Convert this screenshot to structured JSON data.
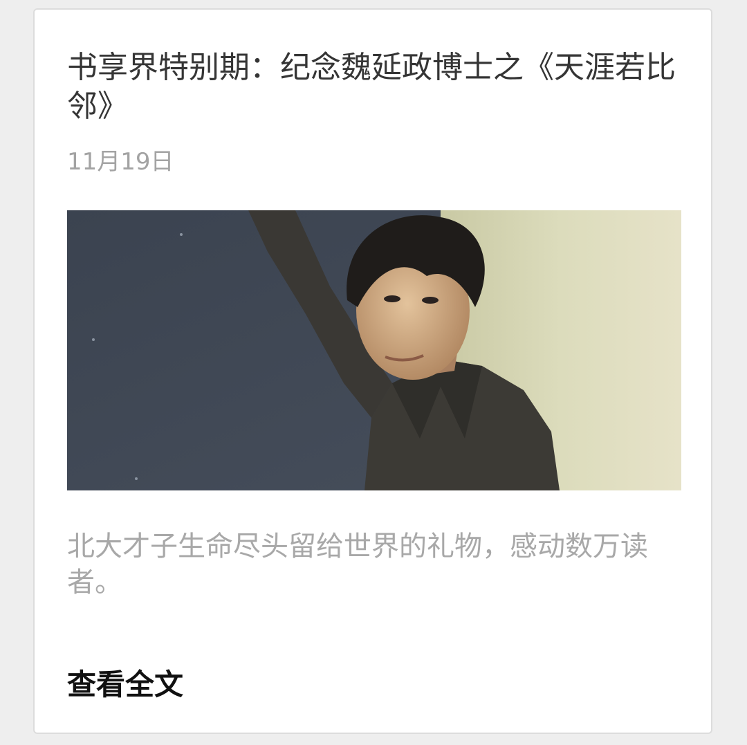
{
  "article": {
    "title": "书享界特别期：纪念魏延政博士之《天涯若比邻》",
    "date": "11月19日",
    "digest": "北大才子生命尽头留给世界的礼物，感动数万读者。",
    "read_more_label": "查看全文"
  },
  "colors": {
    "title": "#353535",
    "meta": "#a3a3a3",
    "link": "#111111",
    "card_border": "#dcdcdc"
  }
}
